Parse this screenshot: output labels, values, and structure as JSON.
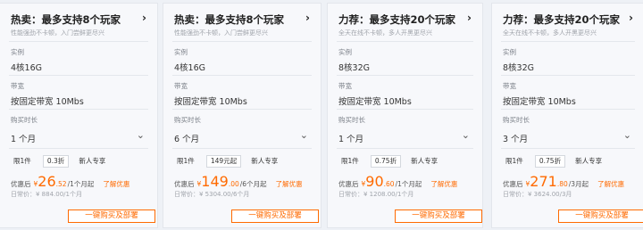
{
  "cards": [
    {
      "title": "热卖：最多支持8个玩家",
      "subtitle": "性能强劲不卡顿，入门尝鲜更尽兴",
      "instance_label": "实例",
      "instance": "4核16G",
      "bandwidth_label": "带宽",
      "bandwidth": "按固定带宽 10Mbs",
      "duration_label": "购买时长",
      "duration": "1 个月",
      "tags": [
        "限1件",
        "0.3折",
        "新人专享"
      ],
      "price_label": "优惠后",
      "currency": "¥",
      "price_int": "26",
      "price_dec": ".52",
      "price_unit": "/1个月起",
      "learn_more": "了解优惠",
      "daily_price": "日常价：¥ 884.00/1个月",
      "buy": "一键购买及部署"
    },
    {
      "title": "热卖：最多支持8个玩家",
      "subtitle": "性能强劲不卡顿，入门尝鲜更尽兴",
      "instance_label": "实例",
      "instance": "4核16G",
      "bandwidth_label": "带宽",
      "bandwidth": "按固定带宽 10Mbs",
      "duration_label": "购买时长",
      "duration": "6 个月",
      "tags": [
        "限1件",
        "149元起",
        "新人专享"
      ],
      "price_label": "优惠后",
      "currency": "¥",
      "price_int": "149",
      "price_dec": ".00",
      "price_unit": "/6个月起",
      "learn_more": "了解优惠",
      "daily_price": "日常价：¥ 5304.00/6个月",
      "buy": "一键购买及部署"
    },
    {
      "title": "力荐：最多支持20个玩家",
      "subtitle": "全天在线不卡顿，多人开黑更尽兴",
      "instance_label": "实例",
      "instance": "8核32G",
      "bandwidth_label": "带宽",
      "bandwidth": "按固定带宽 10Mbs",
      "duration_label": "购买时长",
      "duration": "1 个月",
      "tags": [
        "限1件",
        "0.75折",
        "新人专享"
      ],
      "price_label": "优惠后",
      "currency": "¥",
      "price_int": "90",
      "price_dec": ".60",
      "price_unit": "/1个月起",
      "learn_more": "了解优惠",
      "daily_price": "日常价：¥ 1208.00/1个月",
      "buy": "一键购买及部署"
    },
    {
      "title": "力荐：最多支持20个玩家",
      "subtitle": "全天在线不卡顿，多人开黑更尽兴",
      "instance_label": "实例",
      "instance": "8核32G",
      "bandwidth_label": "带宽",
      "bandwidth": "按固定带宽 10Mbs",
      "duration_label": "购买时长",
      "duration": "3 个月",
      "tags": [
        "限1件",
        "0.75折",
        "新人专享"
      ],
      "price_label": "优惠后",
      "currency": "¥",
      "price_int": "271",
      "price_dec": ".80",
      "price_unit": "/3月起",
      "learn_more": "了解优惠",
      "daily_price": "日常价：¥ 3624.00/3月",
      "buy": "一键购买及部署"
    }
  ],
  "colors": {
    "accent": "#ff6a00",
    "card_bg": "#f7f8fb",
    "page_bg": "#eef1f6"
  },
  "icons": {
    "header": "chevron-right-icon",
    "select": "chevron-down-icon"
  }
}
